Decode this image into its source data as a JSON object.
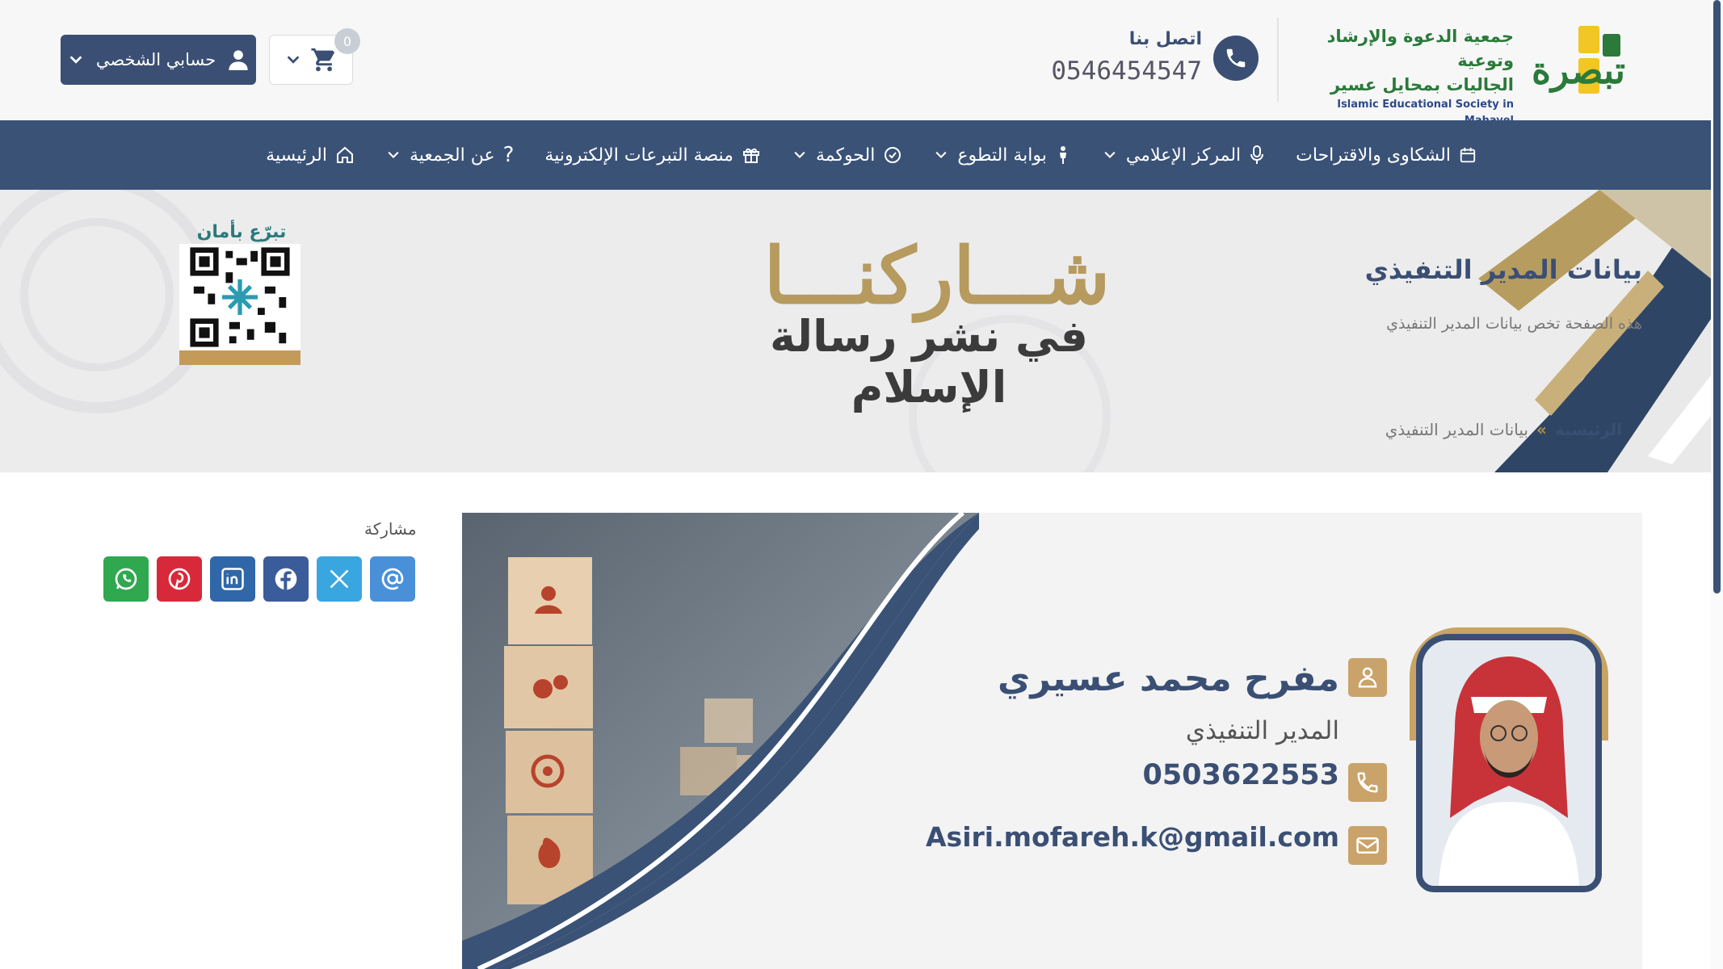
{
  "header": {
    "logo": {
      "name": "تبصرة",
      "line1": "جمعية الدعوة والإرشاد وتوعية",
      "line2": "الجاليات بمحايل عسير",
      "english": "Islamic Educational Society in Mahayel"
    },
    "contact": {
      "label": "اتصل بنا",
      "number": "0546454547"
    },
    "cart": {
      "count": "0"
    },
    "account": {
      "label": "حسابي الشخصي"
    }
  },
  "nav": {
    "items": [
      {
        "label": "الرئيسية",
        "icon": "home-icon",
        "dropdown": false
      },
      {
        "label": "عن الجمعية",
        "icon": "question-icon",
        "dropdown": true
      },
      {
        "label": "منصة التبرعات الإلكترونية",
        "icon": "gift-icon",
        "dropdown": false
      },
      {
        "label": "الحوكمة",
        "icon": "check-circle-icon",
        "dropdown": true
      },
      {
        "label": "بوابة التطوع",
        "icon": "person-icon",
        "dropdown": true
      },
      {
        "label": "المركز الإعلامي",
        "icon": "microphone-icon",
        "dropdown": true
      },
      {
        "label": "الشكاوى والاقتراحات",
        "icon": "calendar-icon",
        "dropdown": false
      }
    ]
  },
  "banner": {
    "title": "بيانات المدير التنفيذي",
    "subtitle": "هذه الصفحة تخص بيانات المدير التنفيذي",
    "breadcrumb": {
      "home": "الرئيسية",
      "separator": "»",
      "current": "بيانات المدير التنفيذي"
    },
    "slogan_main": "شـــاركنـــا",
    "slogan_sub": "في نشر رسالة الإسلام",
    "qr_label": "تبرّع بأمان"
  },
  "share": {
    "label": "مشاركة",
    "buttons": [
      {
        "name": "email",
        "color": "#4a90d9",
        "glyph": "@"
      },
      {
        "name": "x",
        "color": "#3aa6e0",
        "glyph": "X"
      },
      {
        "name": "facebook",
        "color": "#3b5c9a",
        "glyph": "f"
      },
      {
        "name": "linkedin",
        "color": "#2f67a8",
        "glyph": "in"
      },
      {
        "name": "pinterest",
        "color": "#d8293a",
        "glyph": "P"
      },
      {
        "name": "whatsapp",
        "color": "#2fa84f",
        "glyph": "W"
      }
    ]
  },
  "director": {
    "name": "مفرح محمد عسيري",
    "role": "المدير التنفيذي",
    "phone": "0503622553",
    "email": "Asiri.mofareh.k@gmail.com"
  },
  "colors": {
    "primary": "#3a5276",
    "gold": "#c9a36a",
    "green": "#2b7a3a"
  }
}
